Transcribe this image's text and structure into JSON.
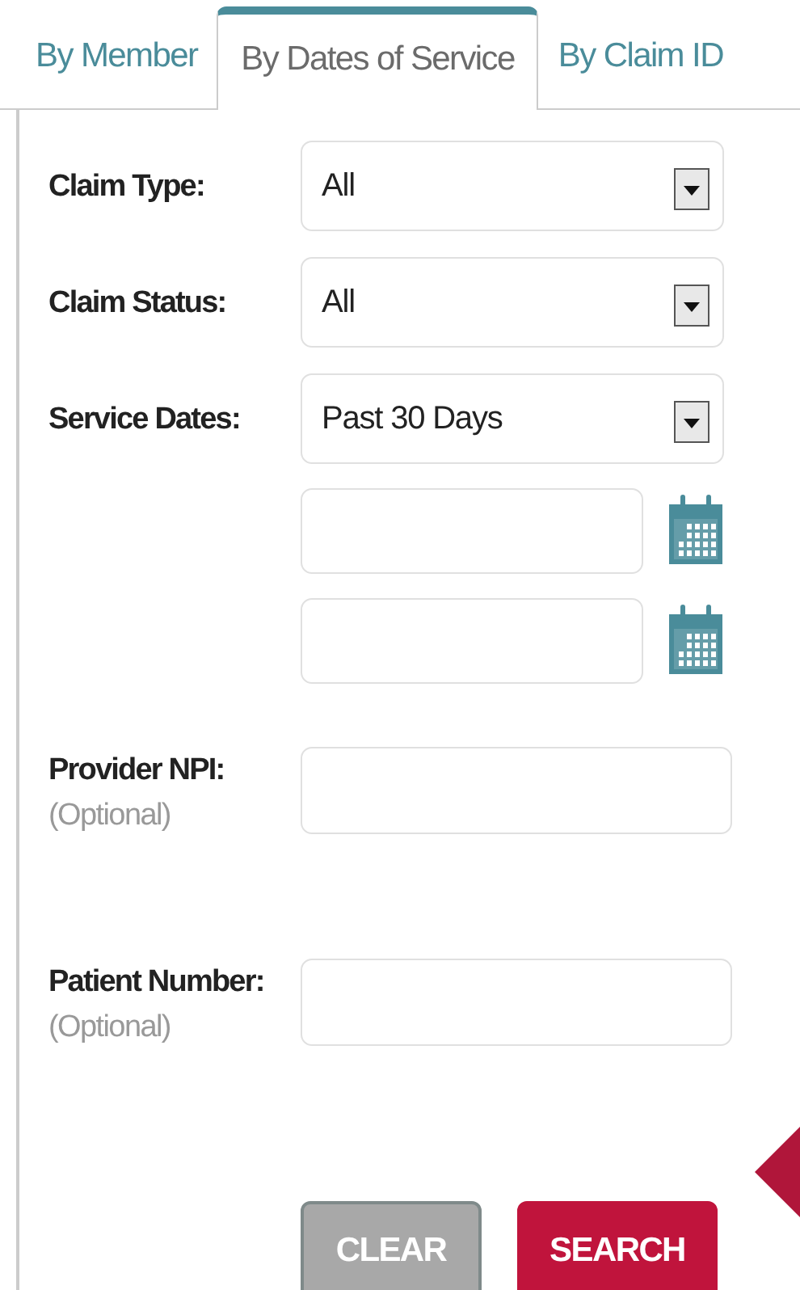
{
  "tabs": [
    {
      "label": "By Member",
      "selected": false
    },
    {
      "label": "By Dates of Service",
      "selected": true
    },
    {
      "label": "By Claim ID",
      "selected": false
    }
  ],
  "fields": [
    {
      "kind": "select",
      "label": "Claim Type:",
      "value": "All"
    },
    {
      "kind": "select",
      "label": "Claim Status:",
      "value": "All"
    },
    {
      "kind": "select",
      "label": "Service Dates:",
      "value": "Past 30 Days"
    },
    {
      "kind": "date"
    },
    {
      "kind": "date"
    },
    {
      "kind": "input",
      "label": "Provider NPI:",
      "note": "(Optional)"
    },
    {
      "kind": "input",
      "label": "Patient Number:",
      "note": "(Optional)"
    }
  ],
  "buttons": [
    {
      "label": "CLEAR",
      "kind": "secondary"
    },
    {
      "label": "SEARCH",
      "kind": "primary"
    }
  ]
}
